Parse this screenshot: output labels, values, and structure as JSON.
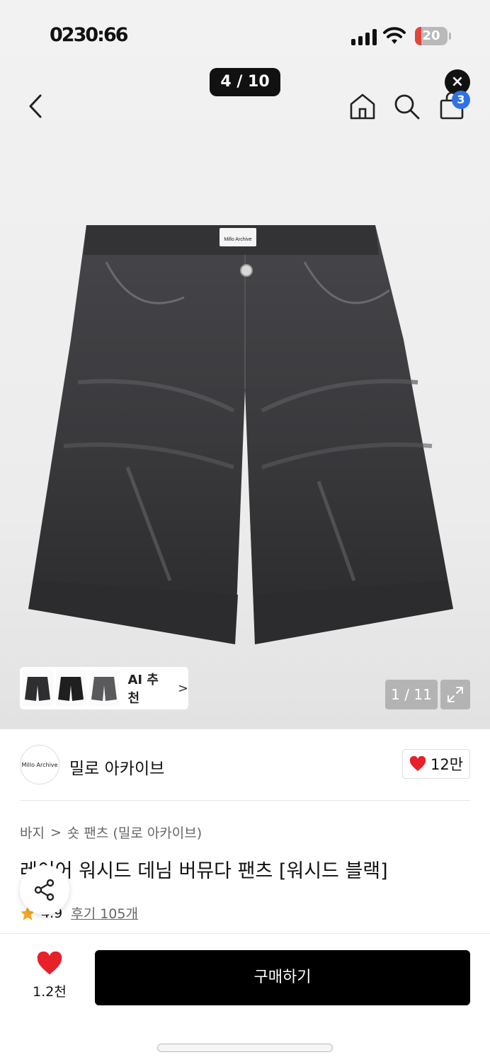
{
  "status_bar": {
    "time": "0230:66",
    "battery": "20",
    "battery_level": 0.2
  },
  "viewer": {
    "pager": "4 / 10",
    "close_label": "×"
  },
  "nav": {
    "cart_count": "3"
  },
  "gallery": {
    "image_counter": "1 / 11",
    "ai_label": "AI 추천",
    "ai_arrow": ">"
  },
  "brand": {
    "logo_text": "Millo Archive",
    "name": "밀로 아카이브",
    "likes": "12만"
  },
  "product": {
    "breadcrumb": [
      "바지",
      ">",
      "숏 팬츠 (밀로 아카이브)"
    ],
    "title": "레이어 워시드 데님 버뮤다 팬츠 [워시드 블랙]",
    "rating": "4.9",
    "reviews": "후기 105개",
    "tag_text": "Millo Archive"
  },
  "bottom_bar": {
    "wish_count": "1.2천",
    "buy_label": "구매하기"
  },
  "colors": {
    "accent_red": "#e8202a",
    "badge_blue": "#2f72e8",
    "star": "#f5a623",
    "denim": "#3a3a3c"
  }
}
